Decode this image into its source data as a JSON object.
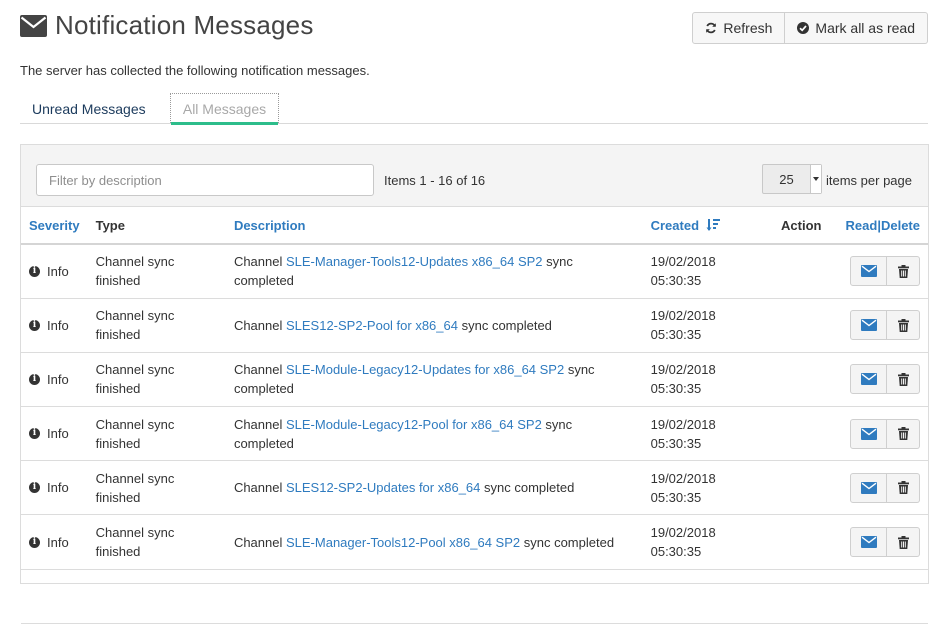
{
  "header": {
    "title": "Notification Messages",
    "refresh_label": "Refresh",
    "mark_all_label": "Mark all as read"
  },
  "intro": "The server has collected the following notification messages.",
  "tabs": [
    {
      "label": "Unread Messages",
      "active": false
    },
    {
      "label": "All Messages",
      "active": true
    }
  ],
  "toolbar": {
    "filter_placeholder": "Filter by description",
    "filter_value": "",
    "items_count": "Items 1 - 16 of 16",
    "per_page_value": "25",
    "per_page_label": "items per page"
  },
  "table": {
    "headers": {
      "severity": "Severity",
      "type": "Type",
      "description": "Description",
      "created": "Created",
      "action": "Action",
      "read": "Read",
      "separator": "|",
      "delete": "Delete"
    },
    "rows": [
      {
        "severity": "Info",
        "type": "Channel sync finished",
        "desc_prefix": "Channel ",
        "channel": "SLE-Manager-Tools12-Updates x86_64 SP2",
        "desc_suffix": " sync completed",
        "date": "19/02/2018",
        "time": "05:30:35"
      },
      {
        "severity": "Info",
        "type": "Channel sync finished",
        "desc_prefix": "Channel ",
        "channel": "SLES12-SP2-Pool for x86_64",
        "desc_suffix": " sync completed",
        "date": "19/02/2018",
        "time": "05:30:35"
      },
      {
        "severity": "Info",
        "type": "Channel sync finished",
        "desc_prefix": "Channel ",
        "channel": "SLE-Module-Legacy12-Updates for x86_64 SP2",
        "desc_suffix": " sync completed",
        "date": "19/02/2018",
        "time": "05:30:35"
      },
      {
        "severity": "Info",
        "type": "Channel sync finished",
        "desc_prefix": "Channel ",
        "channel": "SLE-Module-Legacy12-Pool for x86_64 SP2",
        "desc_suffix": " sync completed",
        "date": "19/02/2018",
        "time": "05:30:35"
      },
      {
        "severity": "Info",
        "type": "Channel sync finished",
        "desc_prefix": "Channel ",
        "channel": "SLES12-SP2-Updates for x86_64",
        "desc_suffix": " sync completed",
        "date": "19/02/2018",
        "time": "05:30:35"
      },
      {
        "severity": "Info",
        "type": "Channel sync finished",
        "desc_prefix": "Channel ",
        "channel": "SLE-Manager-Tools12-Pool x86_64 SP2",
        "desc_suffix": " sync completed",
        "date": "19/02/2018",
        "time": "05:30:35"
      },
      {
        "severity": "",
        "type": "",
        "desc_prefix": "",
        "channel": "",
        "desc_suffix": "",
        "date": "",
        "time": ""
      }
    ]
  },
  "colors": {
    "link": "#2f7bbf",
    "active_tab_underline": "#2dbd8b",
    "text": "#333333"
  },
  "icons": {
    "title": "envelope-icon",
    "refresh": "refresh-icon",
    "mark_all": "check-circle-icon",
    "severity": "info-circle-icon",
    "sort": "sort-desc-icon",
    "read": "envelope-icon",
    "delete": "trash-icon"
  }
}
